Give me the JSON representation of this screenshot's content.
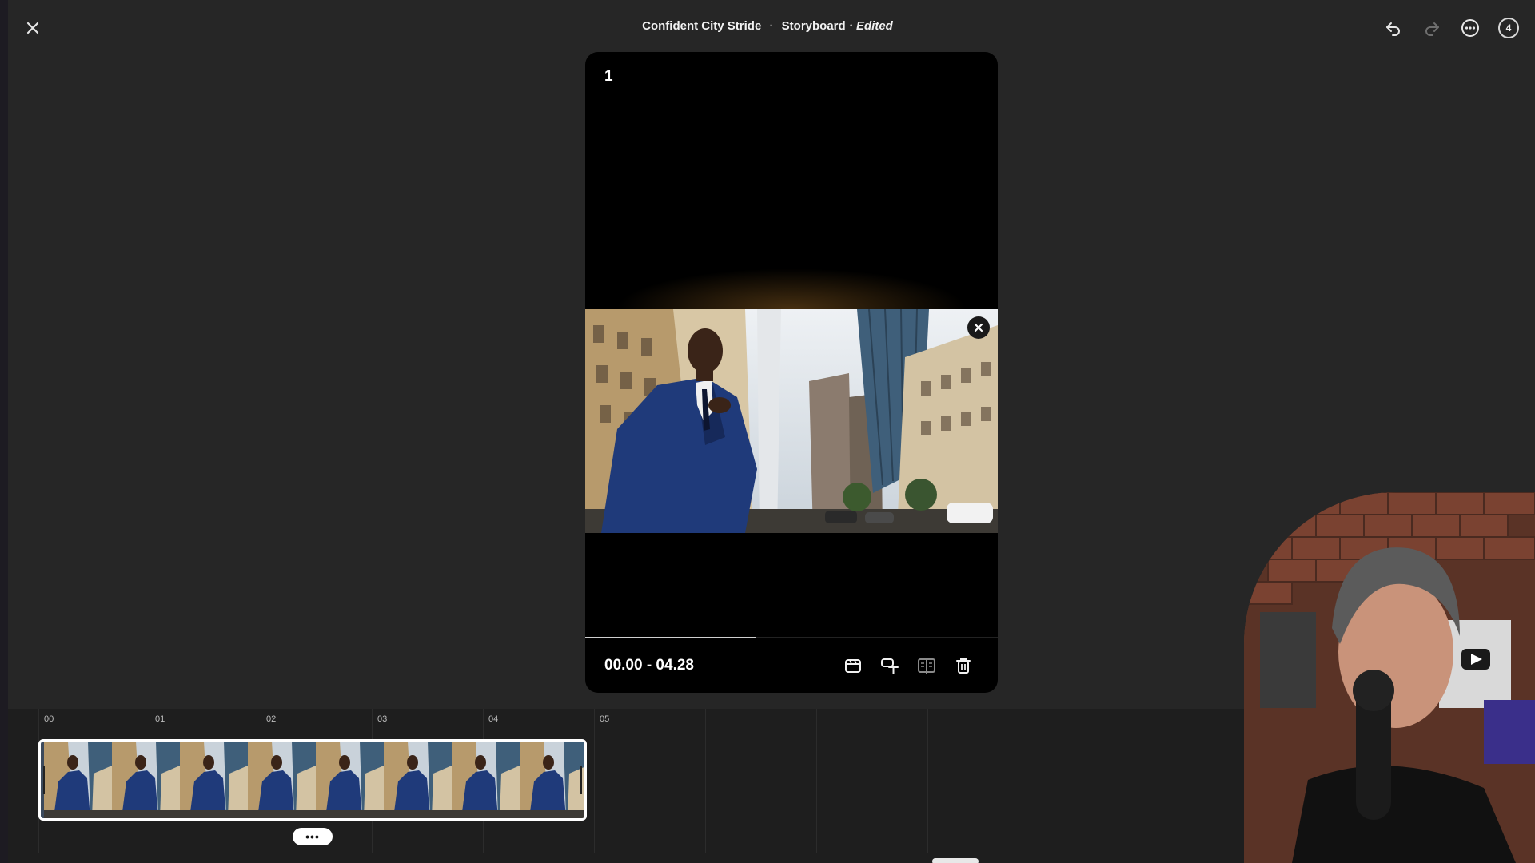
{
  "window": {
    "project_name": "Confident City Stride",
    "separator": "·",
    "mode": "Storyboard",
    "status": "· Edited",
    "notifications_count": "4"
  },
  "icons": {
    "close": "close-icon",
    "undo": "undo-icon",
    "redo": "redo-icon",
    "more": "more-options-icon",
    "media_close": "close-icon",
    "card_tools": [
      "clip-icon",
      "text-style-icon",
      "compare-icon",
      "trash-icon"
    ]
  },
  "preview": {
    "scene_number": "1",
    "time_range": "00.00 - 04.28",
    "progress_fraction": 0.415
  },
  "timeline": {
    "ruler_labels": [
      "00",
      "01",
      "02",
      "03",
      "04",
      "05"
    ],
    "clip_more_label": "•••"
  },
  "colors": {
    "background": "#262626",
    "timeline": "#1e1e1e",
    "card": "#000000",
    "accent": "#ffffff"
  }
}
